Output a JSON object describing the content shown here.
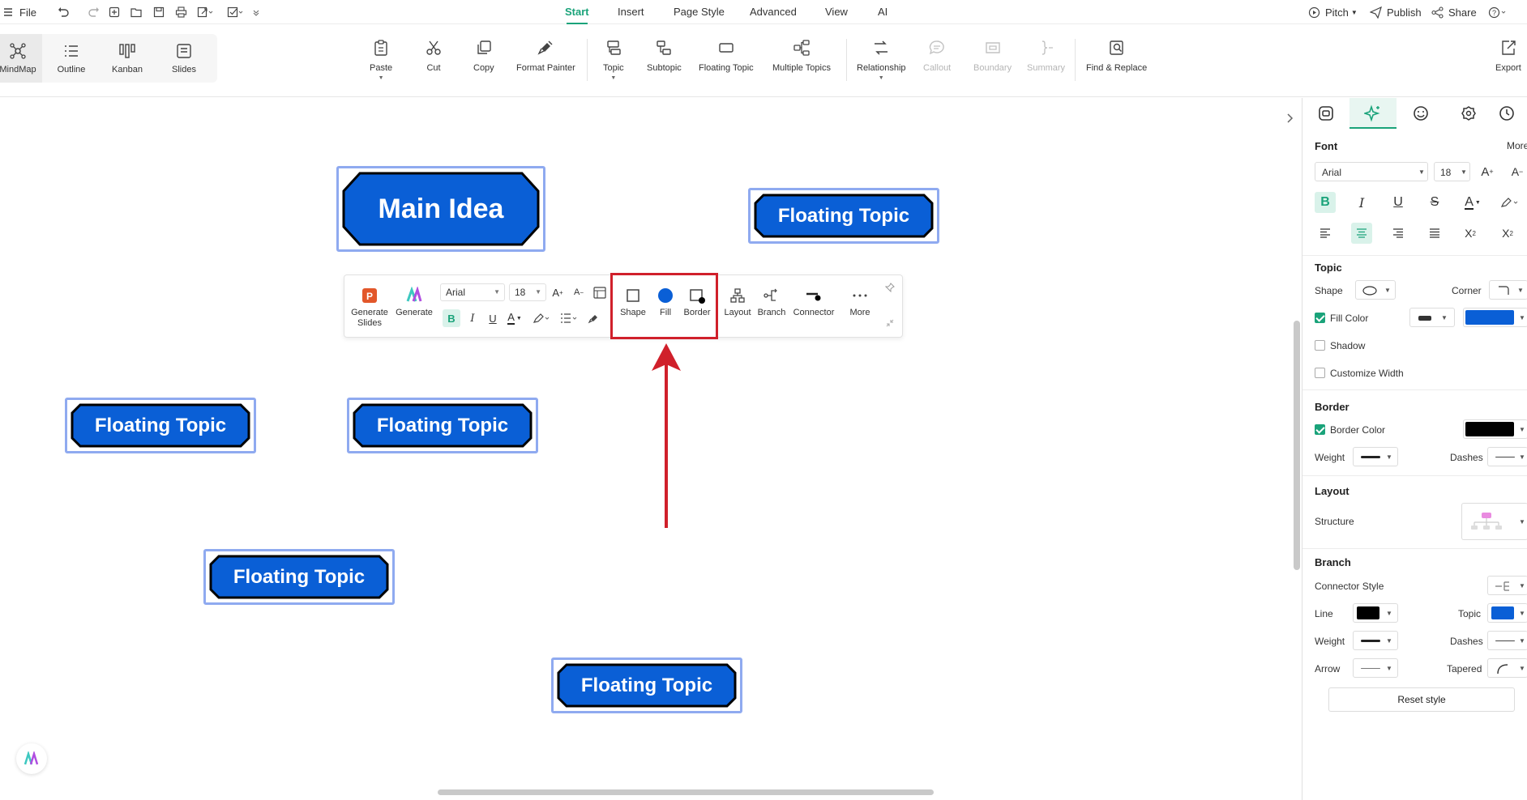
{
  "menubar": {
    "file": "File",
    "tabs": [
      "Start",
      "Insert",
      "Page Style",
      "Advanced",
      "View",
      "AI"
    ],
    "pitch": "Pitch",
    "publish": "Publish",
    "share": "Share"
  },
  "views": [
    "MindMap",
    "Outline",
    "Kanban",
    "Slides"
  ],
  "ribbon": {
    "paste": "Paste",
    "cut": "Cut",
    "copy": "Copy",
    "format_painter": "Format Painter",
    "topic": "Topic",
    "subtopic": "Subtopic",
    "floating_topic": "Floating Topic",
    "multiple_topics": "Multiple Topics",
    "relationship": "Relationship",
    "callout": "Callout",
    "boundary": "Boundary",
    "summary": "Summary",
    "find_replace": "Find & Replace",
    "export": "Export"
  },
  "canvas": {
    "main_idea": "Main Idea",
    "floating_topic": "Floating Topic",
    "topic_fill": "#0a5fd6",
    "topic_border": "#000000",
    "selection_color": "#8faaf0",
    "highlight_color": "#d0202b"
  },
  "floating_toolbar": {
    "generate_slides": "Generate Slides",
    "generate": "Generate",
    "font": "Arial",
    "size": "18",
    "shape": "Shape",
    "fill": "Fill",
    "border": "Border",
    "layout": "Layout",
    "branch": "Branch",
    "connector": "Connector",
    "more": "More"
  },
  "panel": {
    "font_title": "Font",
    "more": "More",
    "font_name": "Arial",
    "font_size": "18",
    "topic_title": "Topic",
    "shape": "Shape",
    "corner": "Corner",
    "fill_color": "Fill Color",
    "shadow": "Shadow",
    "customize_width": "Customize Width",
    "border_title": "Border",
    "border_color": "Border Color",
    "weight": "Weight",
    "dashes": "Dashes",
    "layout_title": "Layout",
    "structure": "Structure",
    "branch_title": "Branch",
    "connector_style": "Connector Style",
    "line": "Line",
    "topic": "Topic",
    "arrow": "Arrow",
    "tapered": "Tapered",
    "reset_style": "Reset style",
    "fill_swatch": "#0a5fd6",
    "border_swatch": "#000000",
    "line_swatch": "#000000",
    "topic_swatch": "#0a5fd6",
    "fill_color_checked": true,
    "border_color_checked": true,
    "shadow_checked": false,
    "customize_width_checked": false
  }
}
